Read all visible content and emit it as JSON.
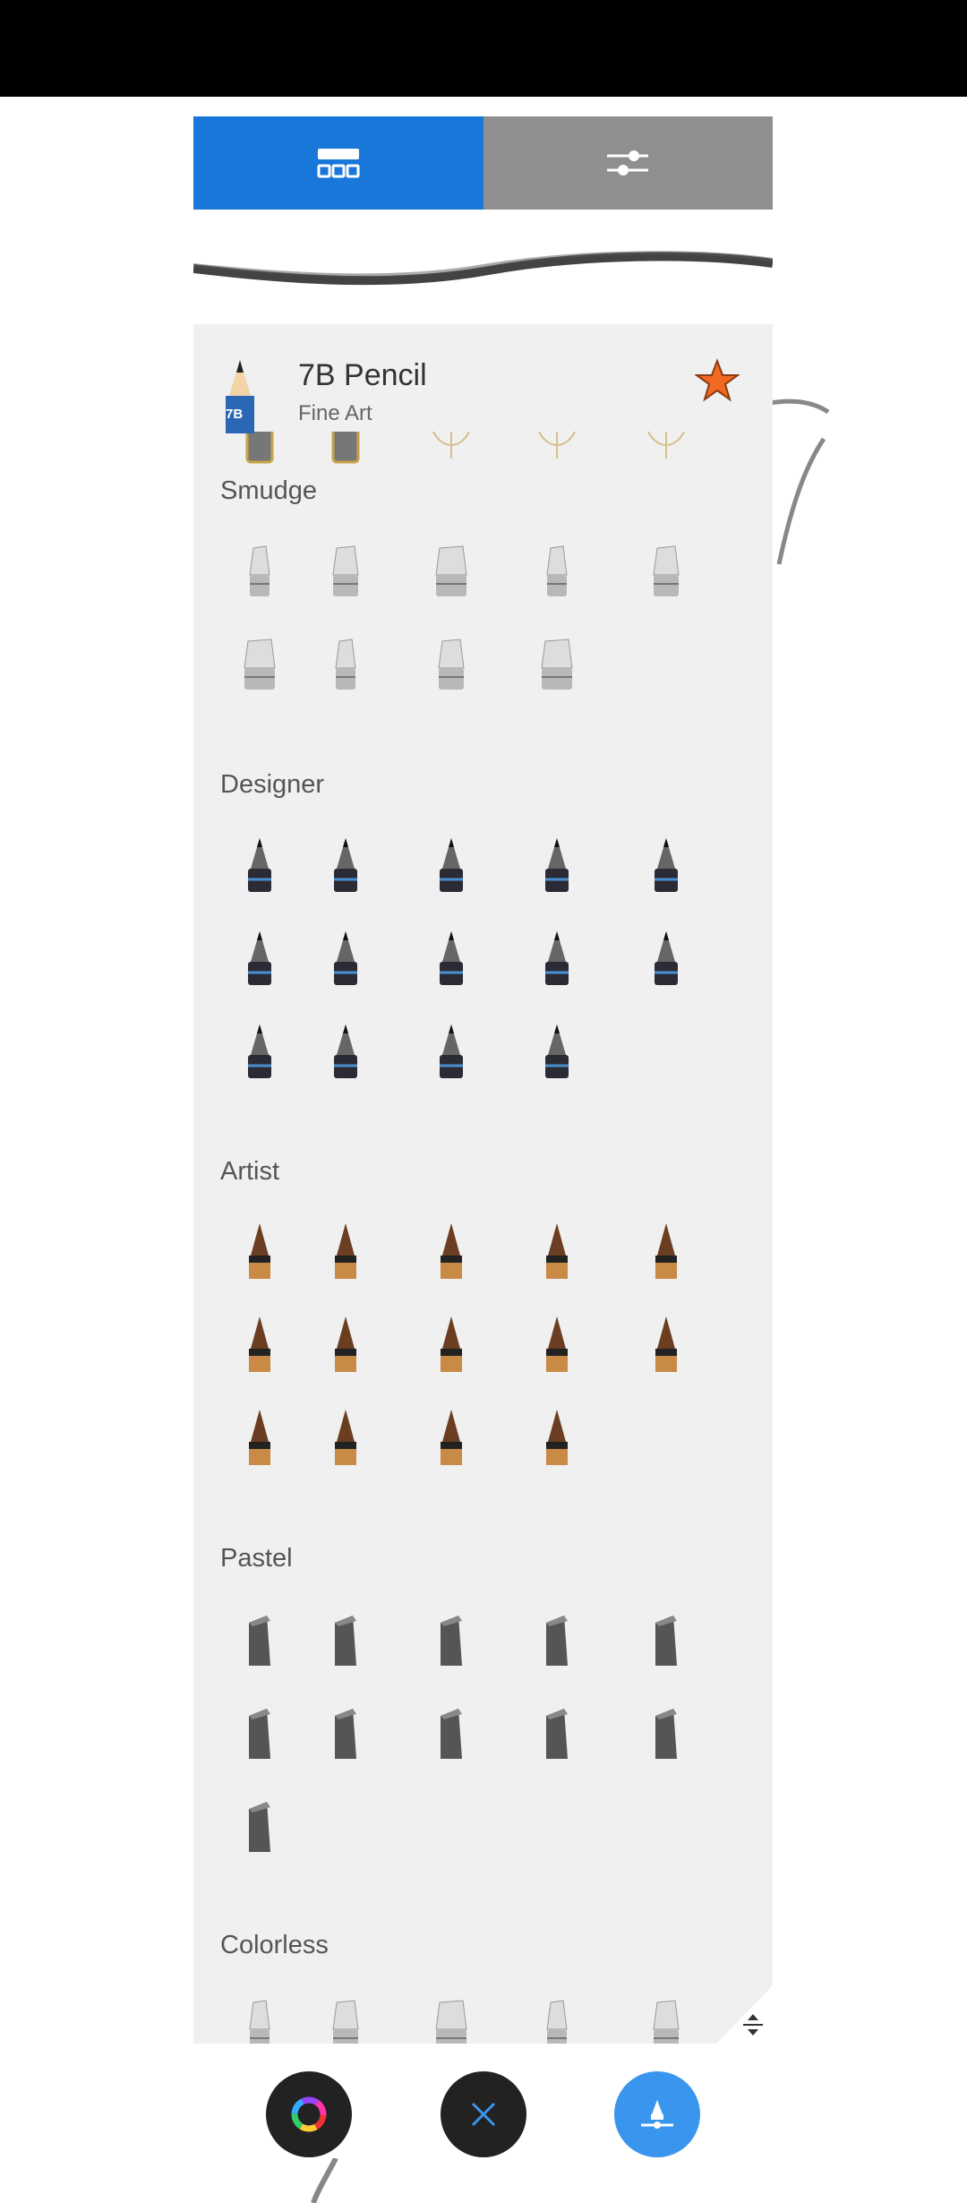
{
  "header": {
    "tabs": [
      {
        "name": "brush-library",
        "icon": "grid-icon",
        "active": true
      },
      {
        "name": "brush-properties",
        "icon": "sliders-icon",
        "active": false
      }
    ]
  },
  "current_brush": {
    "name": "7B Pencil",
    "category": "Fine Art",
    "badge": "7B",
    "favorite": true
  },
  "sections": [
    {
      "label": "Smudge",
      "count": 9,
      "style": "smudge"
    },
    {
      "label": "Designer",
      "count": 14,
      "style": "designer"
    },
    {
      "label": "Artist",
      "count": 14,
      "style": "artist"
    },
    {
      "label": "Pastel",
      "count": 11,
      "style": "pastel"
    },
    {
      "label": "Colorless",
      "count": 6,
      "style": "colorless"
    }
  ],
  "bottom_bar": [
    {
      "name": "color-wheel-button",
      "icon": "color-wheel-icon"
    },
    {
      "name": "close-button",
      "icon": "close-icon"
    },
    {
      "name": "brush-button",
      "icon": "brush-icon"
    }
  ],
  "colors": {
    "accent": "#1877d8",
    "tab_inactive": "#8f8f8f",
    "panel": "#f0f0f0",
    "star": "#f26a22",
    "fab_blue": "#3a95ee"
  }
}
